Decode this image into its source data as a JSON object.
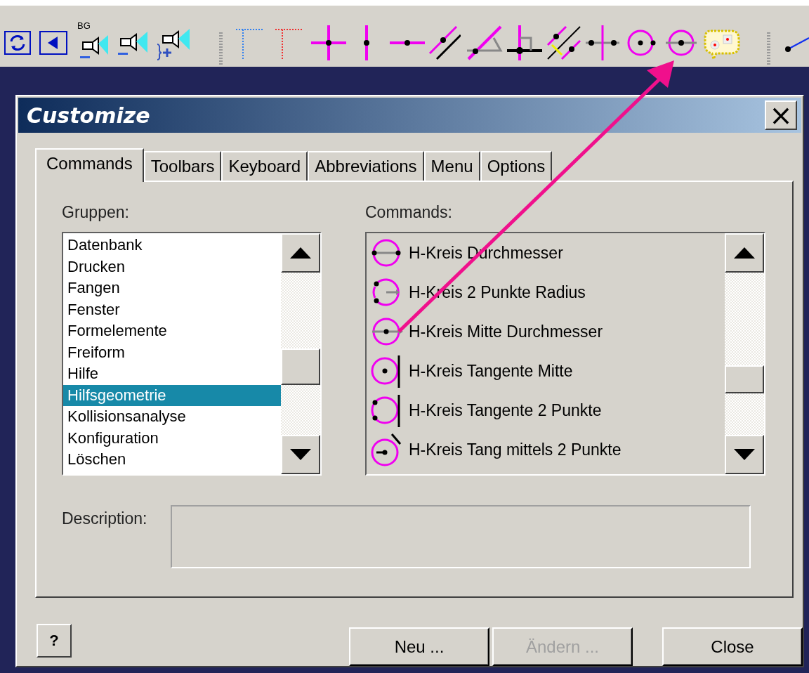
{
  "toolbar": {
    "badge_text": "BG"
  },
  "dialog": {
    "title": "Customize",
    "close_label": "×"
  },
  "tabs": [
    {
      "label": "Commands",
      "selected": true
    },
    {
      "label": "Toolbars",
      "selected": false
    },
    {
      "label": "Keyboard",
      "selected": false
    },
    {
      "label": "Abbreviations",
      "selected": false
    },
    {
      "label": "Menu",
      "selected": false
    },
    {
      "label": "Options",
      "selected": false
    }
  ],
  "groups": {
    "label": "Gruppen:",
    "items": [
      {
        "label": "Datenbank",
        "selected": false
      },
      {
        "label": "Drucken",
        "selected": false
      },
      {
        "label": "Fangen",
        "selected": false
      },
      {
        "label": "Fenster",
        "selected": false
      },
      {
        "label": "Formelemente",
        "selected": false
      },
      {
        "label": "Freiform",
        "selected": false
      },
      {
        "label": "Hilfe",
        "selected": false
      },
      {
        "label": "Hilfsgeometrie",
        "selected": true
      },
      {
        "label": "Kollisionsanalyse",
        "selected": false
      },
      {
        "label": "Konfiguration",
        "selected": false
      },
      {
        "label": "Löschen",
        "selected": false
      }
    ]
  },
  "commands": {
    "label": "Commands:",
    "items": [
      {
        "label": "H-Kreis Durchmesser",
        "kind": "diameter"
      },
      {
        "label": "H-Kreis 2 Punkte  Radius",
        "kind": "radius"
      },
      {
        "label": "H-Kreis Mitte  Durchmesser",
        "kind": "center"
      },
      {
        "label": "H-Kreis Tangente  Mitte",
        "kind": "tangent"
      },
      {
        "label": "H-Kreis Tangente  2 Punkte",
        "kind": "tangent2"
      },
      {
        "label": "H-Kreis Tang mittels 2 Punkte",
        "kind": "slanted"
      }
    ]
  },
  "description": {
    "label": "Description:"
  },
  "help_button": {
    "label": "?"
  },
  "buttons": [
    {
      "label": "Neu ...",
      "disabled": false
    },
    {
      "label": "Ändern ...",
      "disabled": true
    },
    {
      "label": "Close",
      "disabled": false
    }
  ]
}
